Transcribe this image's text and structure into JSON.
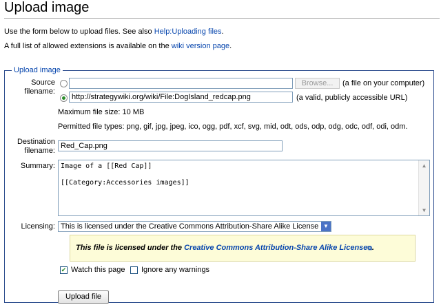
{
  "page": {
    "title": "Upload image",
    "intro1_text": "Use the form below to upload files. See also ",
    "intro1_link": "Help:Uploading files",
    "intro1_end": ".",
    "intro2_text": "A full list of allowed extensions is available on the ",
    "intro2_link": "wiki version page",
    "intro2_end": "."
  },
  "form": {
    "legend": "Upload image",
    "source_label_1": "Source",
    "source_label_2": "filename:",
    "file_input_value": "",
    "browse_label": "Browse...",
    "file_note": "(a file on your computer)",
    "url_value": "http://strategywiki.org/wiki/File:DogIsland_redcap.png",
    "url_note": "(a valid, publicly accessible URL)",
    "max_size": "Maximum file size: 10 MB",
    "permitted": "Permitted file types: png, gif, jpg, jpeg, ico, ogg, pdf, xcf, svg, mid, odt, ods, odp, odg, odc, odf, odi, odm.",
    "dest_label_1": "Destination",
    "dest_label_2": "filename:",
    "dest_value": "Red_Cap.png",
    "summary_label": "Summary:",
    "summary_line1": "Image of a [[Red Cap]]",
    "summary_line2": "[[Category:Accessories images]]",
    "licensing_label": "Licensing:",
    "licensing_selected": "This is licensed under the Creative Commons Attribution-Share Alike License",
    "license_text": "This file is licensed under the ",
    "license_link": "Creative Commons Attribution-Share Alike License",
    "license_end": ".",
    "watch_label": "Watch this page",
    "watch_checked": true,
    "ignore_label": "Ignore any warnings",
    "ignore_checked": false,
    "upload_label": "Upload file"
  },
  "colors": {
    "link": "#0645ad",
    "accent": "#2a4b8d",
    "license_bg": "#fdfcd8"
  },
  "icons": {
    "radio_checked": "radio-checked-icon",
    "external_link": "external-link-icon",
    "checkmark": "checkmark-icon"
  }
}
